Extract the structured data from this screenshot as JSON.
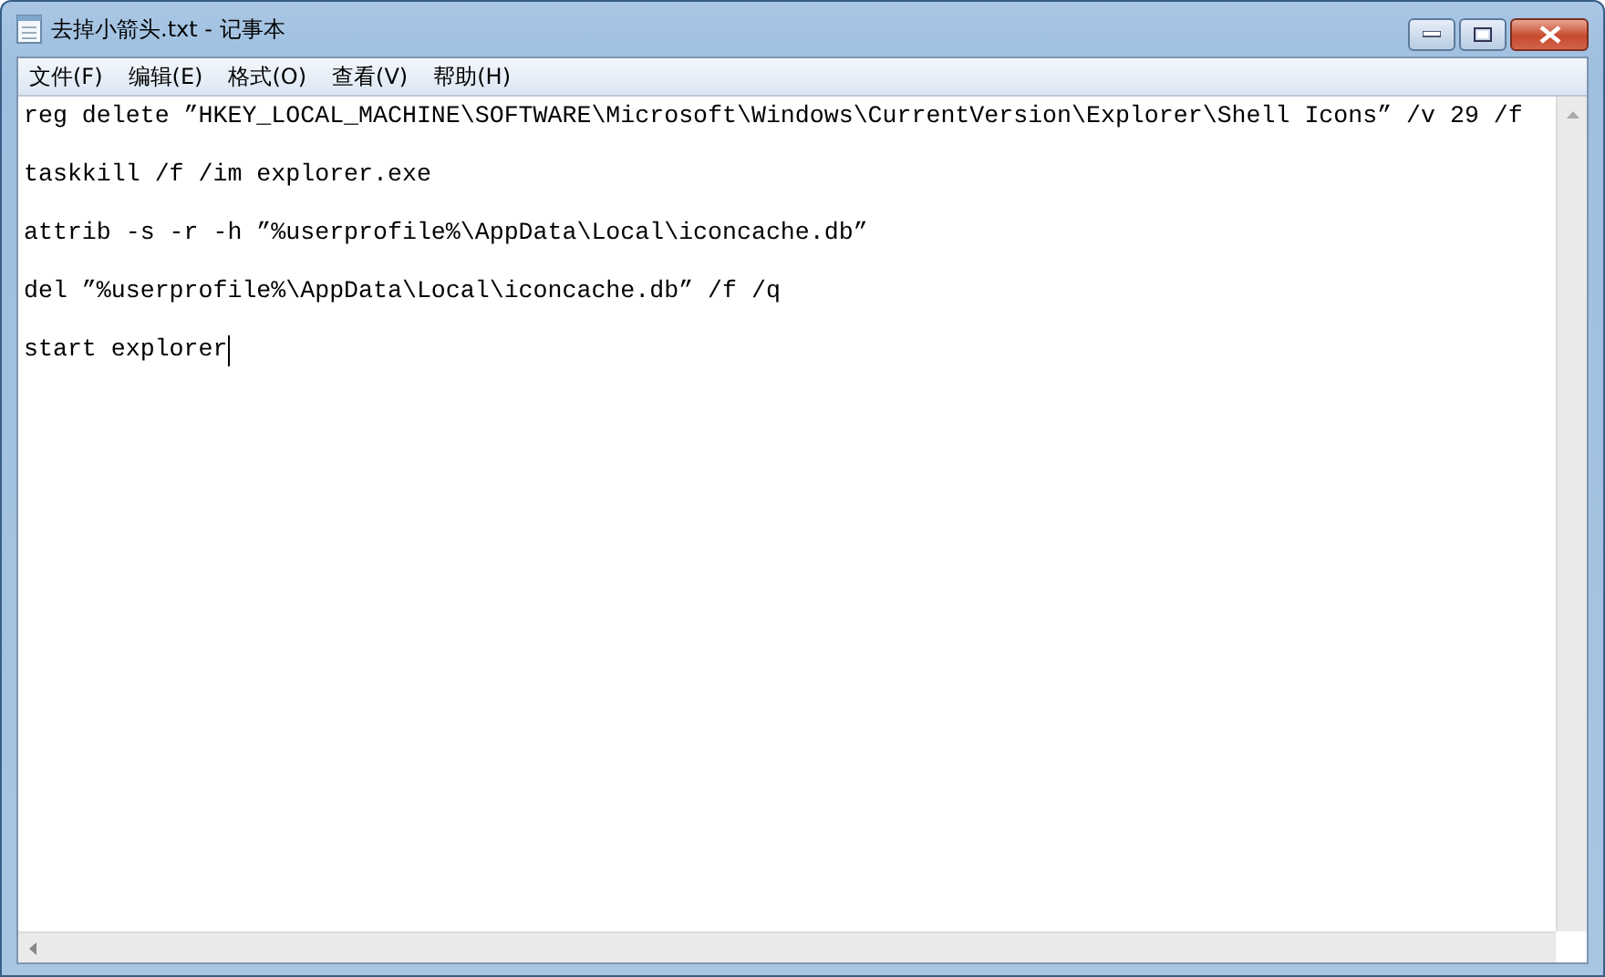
{
  "window": {
    "title": "去掉小箭头.txt - 记事本"
  },
  "menu": [
    "文件(F)",
    "编辑(E)",
    "格式(O)",
    "查看(V)",
    "帮助(H)"
  ],
  "lines": [
    "reg delete ”HKEY_LOCAL_MACHINE\\SOFTWARE\\Microsoft\\Windows\\CurrentVersion\\Explorer\\Shell Icons” /v 29 /f",
    "taskkill /f /im explorer.exe",
    "attrib -s -r -h ”%userprofile%\\AppData\\Local\\iconcache.db”",
    "del ”%userprofile%\\AppData\\Local\\iconcache.db” /f /q",
    "start explorer"
  ]
}
